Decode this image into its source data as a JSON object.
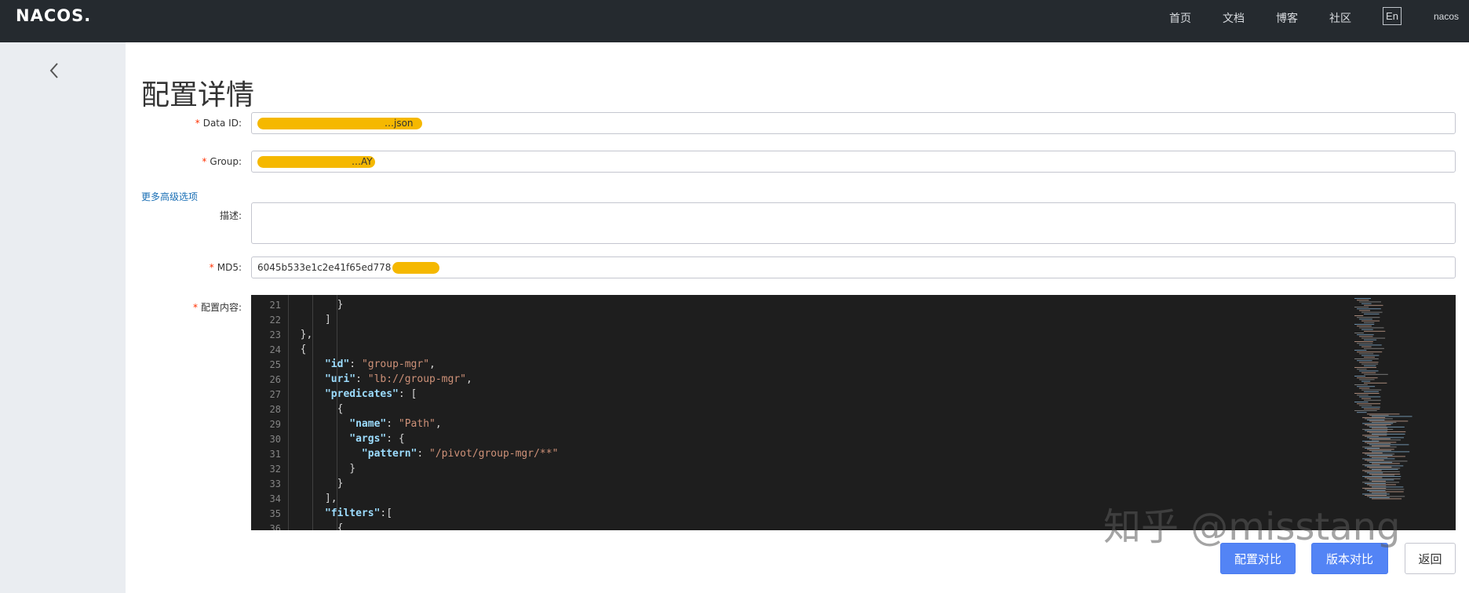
{
  "topbar": {
    "logo": "NACOS.",
    "nav": [
      "首页",
      "文档",
      "博客",
      "社区"
    ],
    "lang_button": "En",
    "user": "nacos"
  },
  "page": {
    "title": "配置详情"
  },
  "form": {
    "data_id": {
      "label": "Data ID:",
      "value": "…json"
    },
    "group": {
      "label": "Group:",
      "value": "…AY"
    },
    "advanced_link": "更多高级选项",
    "description": {
      "label": "描述:",
      "value": ""
    },
    "md5": {
      "label": "MD5:",
      "value": "6045b533e1c2e41f65ed778"
    },
    "content": {
      "label": "配置内容:"
    }
  },
  "editor": {
    "line_numbers": [
      "21",
      "22",
      "23",
      "24",
      "25",
      "26",
      "27",
      "28",
      "29",
      "30",
      "31",
      "32",
      "33",
      "34",
      "35",
      "36"
    ],
    "lines": [
      "        }",
      "      ]",
      "  },",
      "  {",
      "      \"id\": \"group-mgr\",",
      "      \"uri\": \"lb://group-mgr\",",
      "      \"predicates\": [",
      "        {",
      "          \"name\": \"Path\",",
      "          \"args\": {",
      "            \"pattern\": \"/pivot/group-mgr/**\"",
      "          }",
      "        }",
      "      ],",
      "      \"filters\":[",
      "        {"
    ]
  },
  "buttons": {
    "compare_config": "配置对比",
    "compare_version": "版本对比",
    "back": "返回"
  },
  "watermark": "知乎 @misstang",
  "colors": {
    "topbar_bg": "#252a2f",
    "sidebar_bg": "#eaedf1",
    "primary_button": "#5384f5",
    "editor_bg": "#1e1e1e",
    "json_key": "#9cdcfe",
    "json_string": "#ce9178",
    "redaction": "#f5b800"
  },
  "icons": {
    "back": "chevron-left-icon"
  }
}
